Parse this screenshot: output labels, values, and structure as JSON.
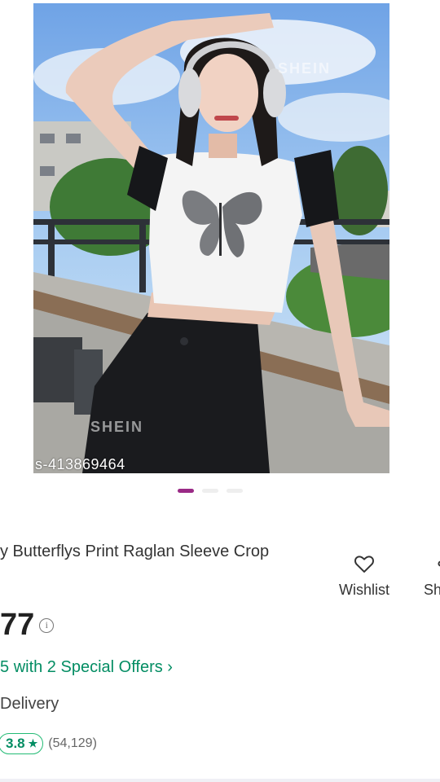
{
  "product": {
    "image_id": "s-413869464",
    "watermark": "SHEIN",
    "carousel": {
      "total": 3,
      "active_index": 0
    },
    "title": "y Butterflys Print Raglan Sleeve Crop",
    "price": "77",
    "offers": "with 2 Special Offers ›",
    "offers_prefix": "5",
    "delivery": "Delivery",
    "rating": "3.8",
    "rating_star": "★",
    "rating_count": "(54,129)"
  },
  "actions": {
    "wishlist_label": "Wishlist",
    "wishlist_icon": "heart-icon",
    "share_label": "Sh",
    "share_icon": "share-icon"
  },
  "colors": {
    "accent_dot": "#9a2a86",
    "offer_green": "#038d63",
    "rating_border": "#23bb75"
  }
}
